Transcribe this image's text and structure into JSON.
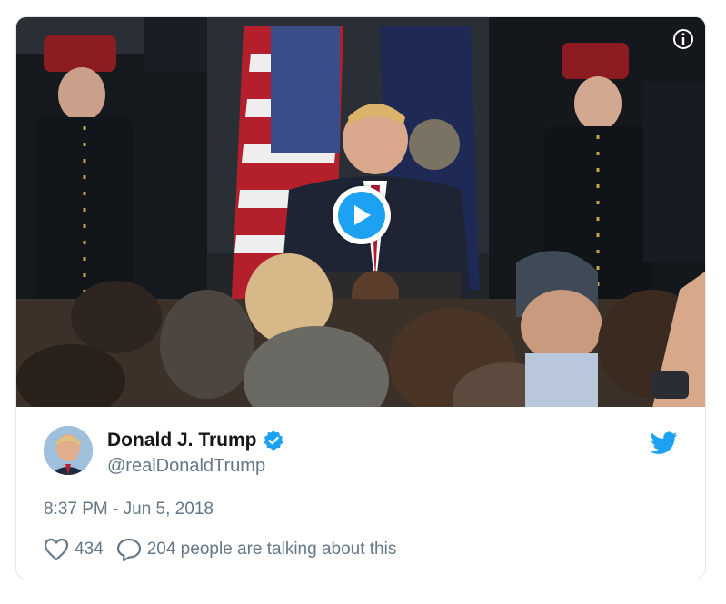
{
  "tweet": {
    "display_name": "Donald J. Trump",
    "handle": "@realDonaldTrump",
    "timestamp": "8:37 PM - Jun 5, 2018",
    "likes": "434",
    "conversation": "204 people are talking about this"
  },
  "icons": {
    "info": "info-icon",
    "play": "play-icon",
    "verified": "verified-badge-icon",
    "twitter": "twitter-bird-icon",
    "like": "heart-icon",
    "reply": "speech-bubble-icon"
  },
  "colors": {
    "brand": "#1da1f2",
    "text_primary": "#14171a",
    "text_secondary": "#657786",
    "border": "#e1e8ed"
  }
}
